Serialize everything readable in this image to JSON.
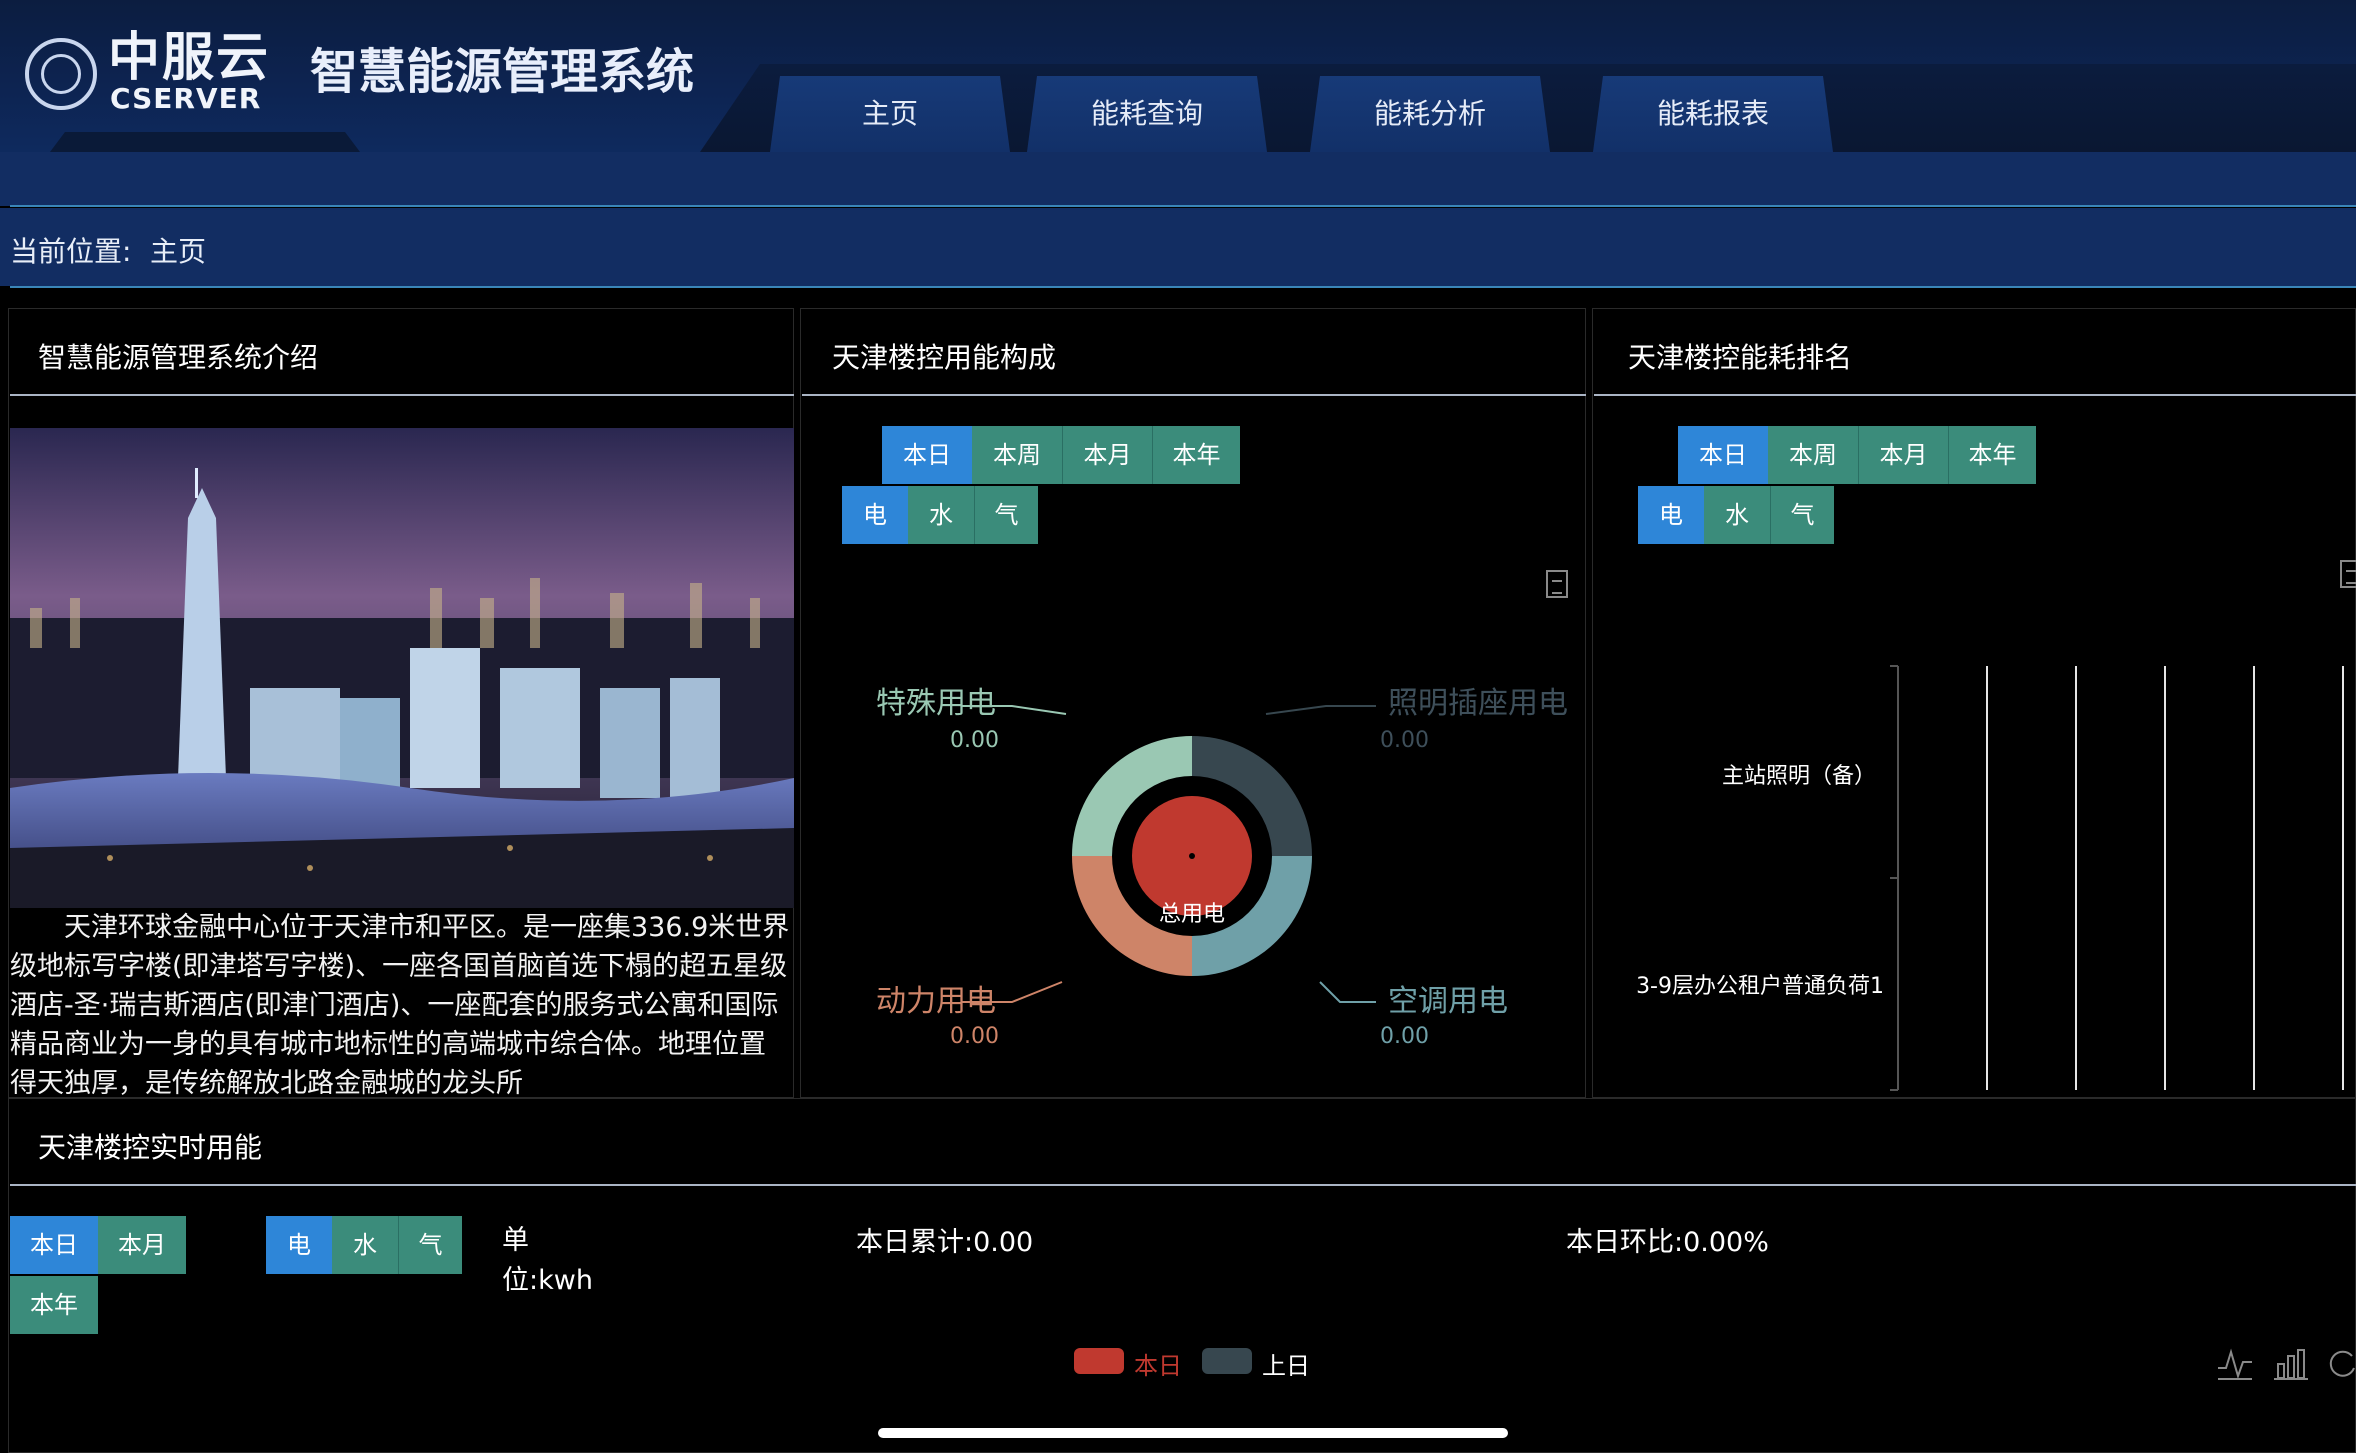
{
  "header": {
    "logo_cn": "中服云",
    "logo_en": "CSERVER",
    "system_title": "智慧能源管理系统",
    "nav_tabs": [
      "主页",
      "能耗查询",
      "能耗分析",
      "能耗报表"
    ]
  },
  "breadcrumb": {
    "label": "当前位置:",
    "current": "主页"
  },
  "intro_panel": {
    "title": "智慧能源管理系统介绍",
    "text": "天津环球金融中心位于天津市和平区。是一座集336.9米世界级地标写字楼(即津塔写字楼)、一座各国首脑首选下榻的超五星级酒店-圣·瑞吉斯酒店(即津门酒店)、一座配套的服务式公寓和国际精品商业为一身的具有城市地标性的高端城市综合体。地理位置得天独厚，是传统解放北路金融城的龙头所"
  },
  "composition_panel": {
    "title": "天津楼控用能构成",
    "period_buttons": [
      "本日",
      "本周",
      "本月",
      "本年"
    ],
    "energy_buttons": [
      "电",
      "水",
      "气"
    ],
    "center_label": "总用电",
    "chart_data": {
      "type": "pie",
      "categories": [
        "照明插座用电",
        "空调用电",
        "动力用电",
        "特殊用电"
      ],
      "values": [
        0.0,
        0.0,
        0.0,
        0.0
      ],
      "value_labels": [
        "0.00",
        "0.00",
        "0.00",
        "0.00"
      ],
      "colors": [
        "#37474f",
        "#6fa0a8",
        "#ce8468",
        "#9ac8b3"
      ],
      "center_color": "#c0392f"
    }
  },
  "ranking_panel": {
    "title": "天津楼控能耗排名",
    "period_buttons": [
      "本日",
      "本周",
      "本月",
      "本年"
    ],
    "energy_buttons": [
      "电",
      "水",
      "气"
    ],
    "chart_data": {
      "type": "bar",
      "orientation": "horizontal",
      "categories": [
        "主站照明（备）",
        "3-9层办公租户普通负荷1"
      ],
      "values": [
        0,
        0
      ],
      "grid": true
    }
  },
  "realtime_panel": {
    "title": "天津楼控实时用能",
    "period_buttons": [
      "本日",
      "本月",
      "本年"
    ],
    "energy_buttons": [
      "电",
      "水",
      "气"
    ],
    "unit_line1": "单",
    "unit_line2": "位:kwh",
    "daily_total": "本日累计:0.00",
    "daily_ratio": "本日环比:0.00%",
    "legend": [
      {
        "name": "本日",
        "color": "#c0392f"
      },
      {
        "name": "上日",
        "color": "#37474f"
      }
    ]
  },
  "colors": {
    "header_bg": "#0d2452",
    "nav_bar": "#122d62",
    "accent_line": "#3a86b8",
    "button_active": "#2e86d8",
    "button_normal": "#3b8c7b"
  }
}
